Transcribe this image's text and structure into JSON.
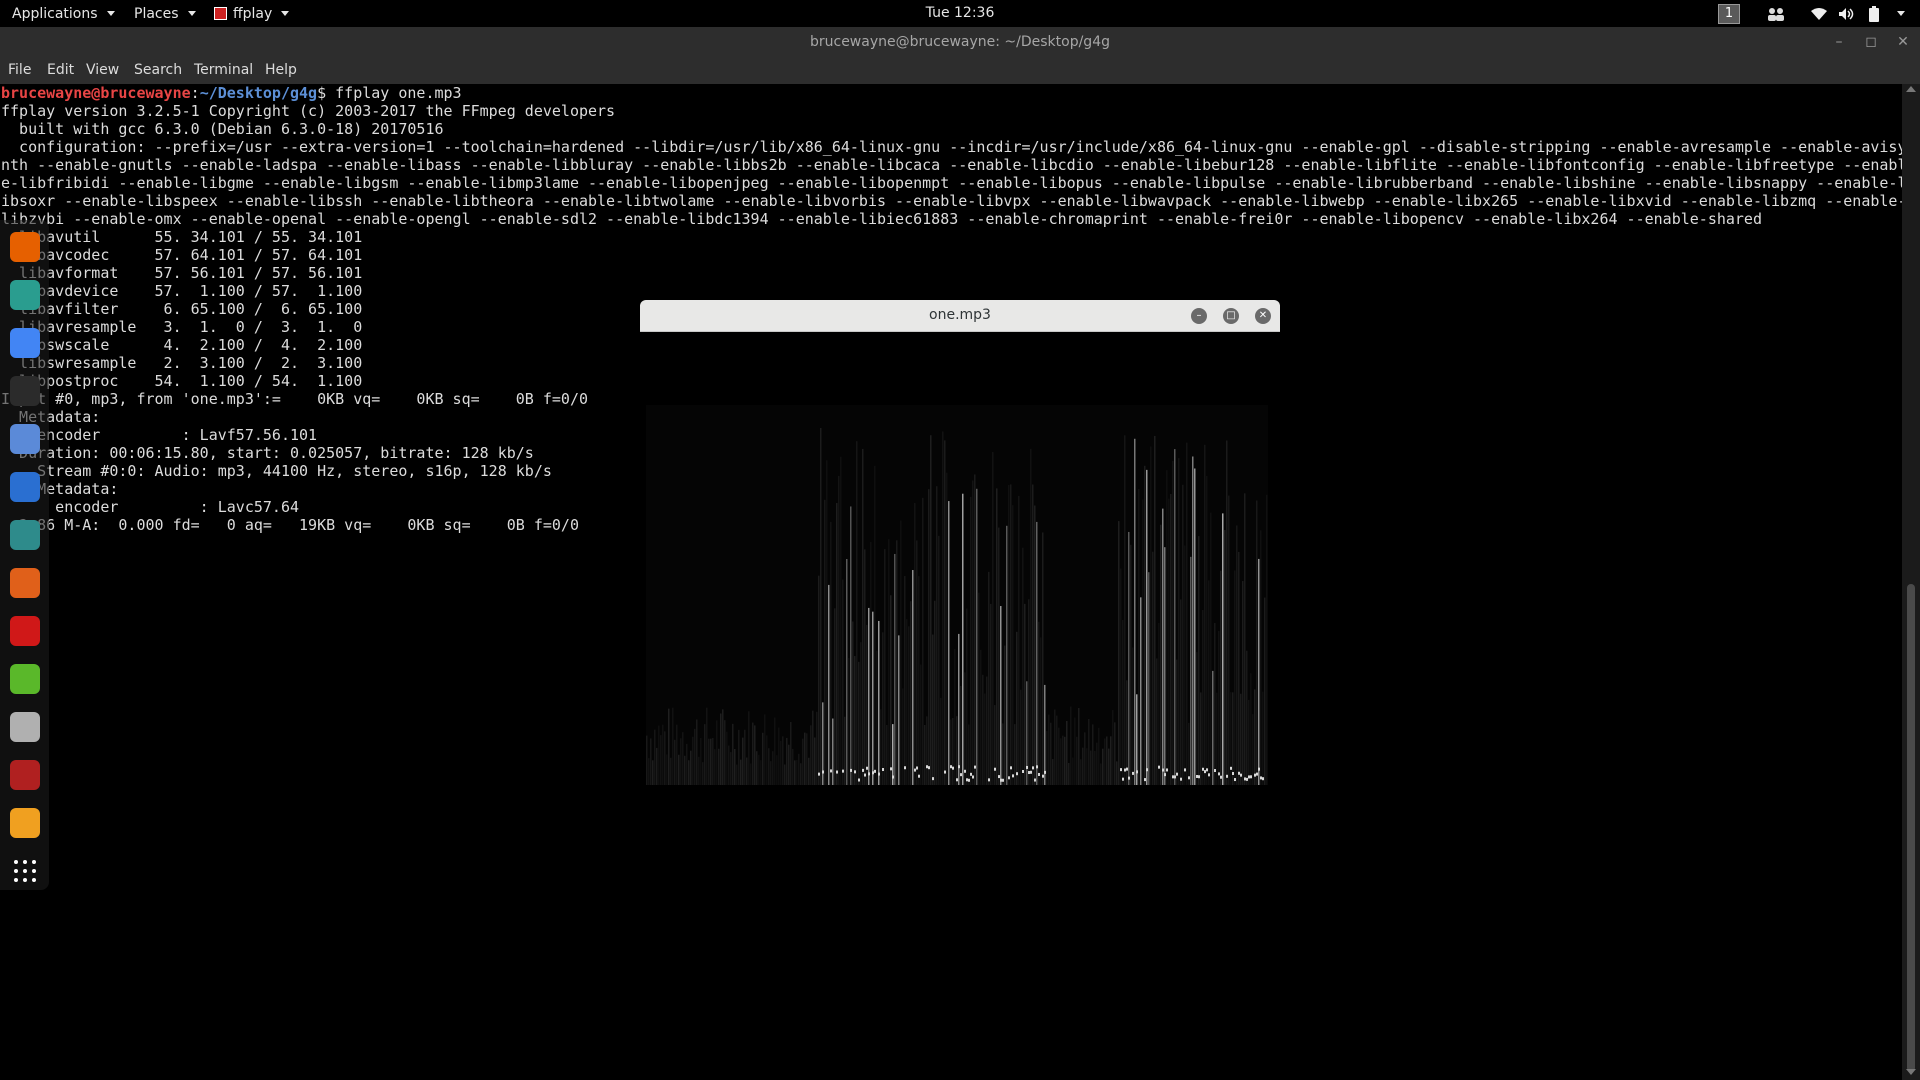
{
  "topbar": {
    "applications": "Applications",
    "places": "Places",
    "active_app": "ffplay",
    "clock": "Tue 12:36",
    "workspace": "1"
  },
  "terminal": {
    "title": "brucewayne@brucewayne: ~/Desktop/g4g",
    "menu": [
      "File",
      "Edit",
      "View",
      "Search",
      "Terminal",
      "Help"
    ],
    "prompt_user": "brucewayne@brucewayne",
    "prompt_path": "~/Desktop/g4g",
    "command": "$ ffplay one.mp3",
    "output": [
      "ffplay version 3.2.5-1 Copyright (c) 2003-2017 the FFmpeg developers",
      "  built with gcc 6.3.0 (Debian 6.3.0-18) 20170516",
      "  configuration: --prefix=/usr --extra-version=1 --toolchain=hardened --libdir=/usr/lib/x86_64-linux-gnu --incdir=/usr/include/x86_64-linux-gnu --enable-gpl --disable-stripping --enable-avresample --enable-avisy",
      "nth --enable-gnutls --enable-ladspa --enable-libass --enable-libbluray --enable-libbs2b --enable-libcaca --enable-libcdio --enable-libebur128 --enable-libflite --enable-libfontconfig --enable-libfreetype --enabl",
      "e-libfribidi --enable-libgme --enable-libgsm --enable-libmp3lame --enable-libopenjpeg --enable-libopenmpt --enable-libopus --enable-libpulse --enable-librubberband --enable-libshine --enable-libsnappy --enable-l",
      "ibsoxr --enable-libspeex --enable-libssh --enable-libtheora --enable-libtwolame --enable-libvorbis --enable-libvpx --enable-libwavpack --enable-libwebp --enable-libx265 --enable-libxvid --enable-libzmq --enable-",
      "libzvbi --enable-omx --enable-openal --enable-opengl --enable-sdl2 --enable-libdc1394 --enable-libiec61883 --enable-chromaprint --enable-frei0r --enable-libopencv --enable-libx264 --enable-shared",
      "  libavutil      55. 34.101 / 55. 34.101",
      "  libavcodec     57. 64.101 / 57. 64.101",
      "  libavformat    57. 56.101 / 57. 56.101",
      "  libavdevice    57.  1.100 / 57.  1.100",
      "  libavfilter     6. 65.100 /  6. 65.100",
      "  libavresample   3.  1.  0 /  3.  1.  0",
      "  libswscale      4.  2.100 /  4.  2.100",
      "  libswresample   2.  3.100 /  2.  3.100",
      "  libpostproc    54.  1.100 / 54.  1.100",
      "Input #0, mp3, from 'one.mp3':=    0KB vq=    0KB sq=    0B f=0/0",
      "  Metadata:",
      "    encoder         : Lavf57.56.101",
      "  Duration: 00:06:15.80, start: 0.025057, bitrate: 128 kb/s",
      "    Stream #0:0: Audio: mp3, 44100 Hz, stereo, s16p, 128 kb/s",
      "    Metadata:",
      "      encoder         : Lavc57.64",
      "  2.86 M-A:  0.000 fd=   0 aq=   19KB vq=    0KB sq=    0B f=0/0"
    ]
  },
  "ffplay_window": {
    "title": "one.mp3"
  },
  "dock": {
    "apps": [
      {
        "icon": "firefox-icon",
        "color": "#e66000"
      },
      {
        "icon": "network-tool-icon",
        "color": "#2a9d8f"
      },
      {
        "icon": "chrome-icon",
        "color": "#4285f4"
      },
      {
        "icon": "terminal-icon",
        "color": "#2b2b2b"
      },
      {
        "icon": "files-icon",
        "color": "#5b8ad8"
      },
      {
        "icon": "metasploit-icon",
        "color": "#2a6fd1"
      },
      {
        "icon": "user-tool-icon",
        "color": "#2e8b8b"
      },
      {
        "icon": "burpsuite-icon",
        "color": "#e0601a"
      },
      {
        "icon": "faraday-icon",
        "color": "#d01818"
      },
      {
        "icon": "text-editor-icon",
        "color": "#5ab82a"
      },
      {
        "icon": "screenshot-icon",
        "color": "#b0b0b0"
      },
      {
        "icon": "video-app-icon",
        "color": "#b02020"
      },
      {
        "icon": "sublime-icon",
        "color": "#f0a020"
      },
      {
        "icon": "show-apps-icon",
        "color": "#ffffff"
      }
    ]
  }
}
